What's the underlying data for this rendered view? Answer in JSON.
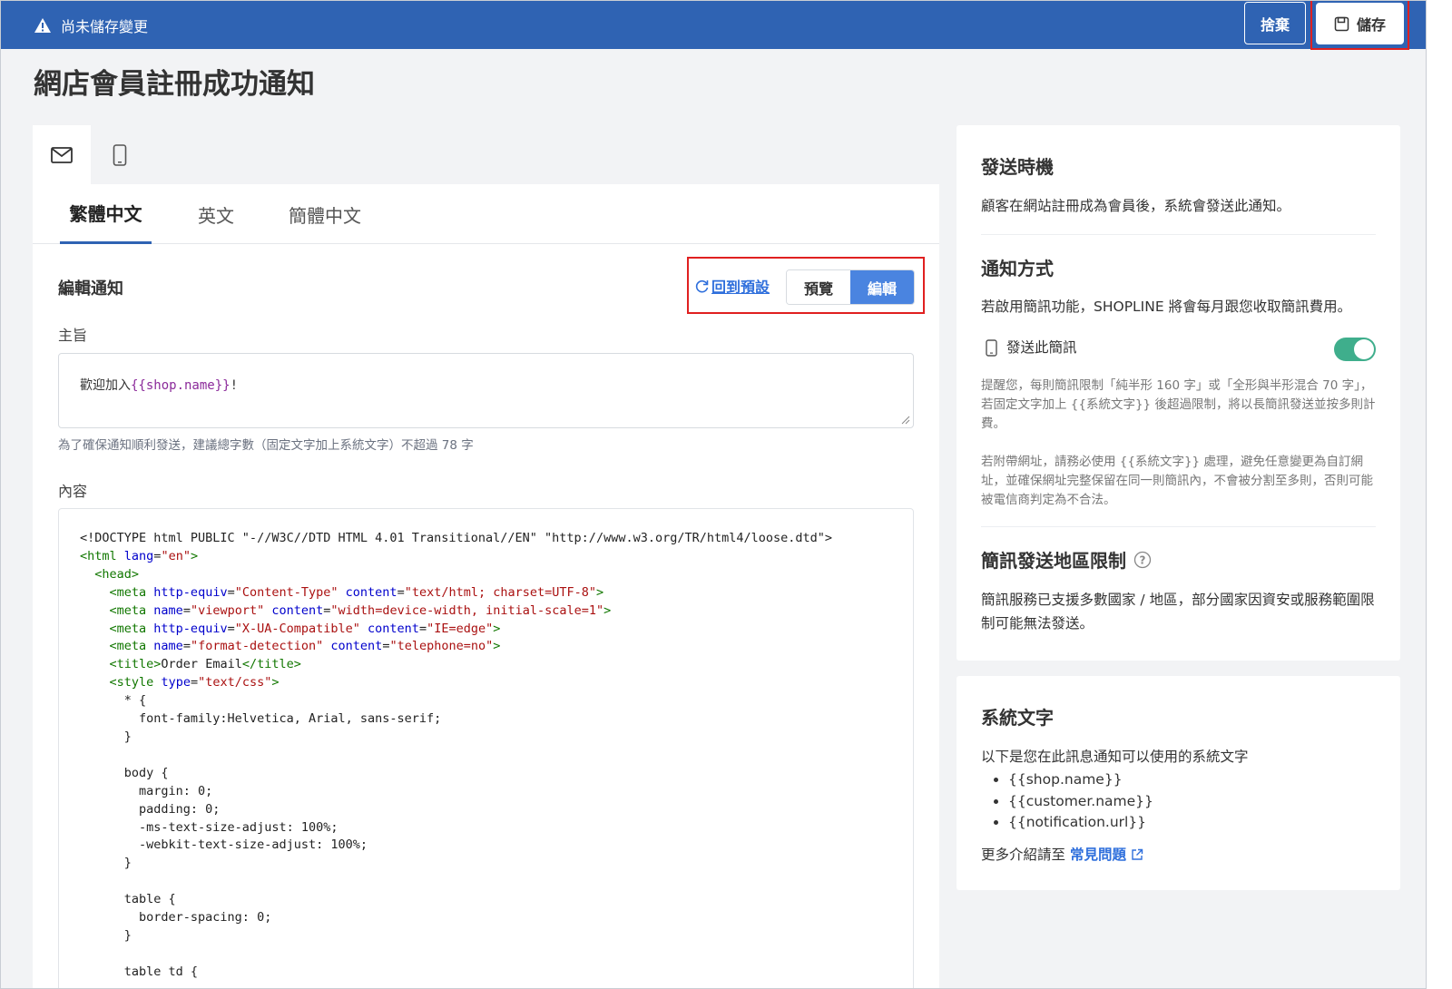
{
  "topbar": {
    "unsaved_text": "尚未儲存變更",
    "discard_label": "捨棄",
    "save_label": "儲存"
  },
  "page": {
    "title": "網店會員註冊成功通知"
  },
  "editor": {
    "lang_tabs": [
      "繁體中文",
      "英文",
      "簡體中文"
    ],
    "section_title": "編輯通知",
    "reset_label": "回到預設",
    "preview_label": "預覽",
    "edit_label": "編輯",
    "subject_label": "主旨",
    "subject_prefix": "歡迎加入",
    "subject_var": "{{shop.name}}",
    "subject_suffix": "!",
    "subject_hint": "為了確保通知順利發送，建議總字數（固定文字加上系統文字）不超過 78 字",
    "content_label": "內容"
  },
  "send_timing": {
    "title": "發送時機",
    "desc": "顧客在網站註冊成為會員後，系統會發送此通知。"
  },
  "notify_method": {
    "title": "通知方式",
    "desc": "若啟用簡訊功能，SHOPLINE 將會每月跟您收取簡訊費用。",
    "sms_label": "發送此簡訊",
    "sms_enabled": true,
    "note1": "提醒您，每則簡訊限制「純半形 160 字」或「全形與半形混合 70 字」，若固定文字加上 {{系統文字}} 後超過限制，將以長簡訊發送並按多則計費。",
    "note2": "若附帶網址，請務必使用 {{系統文字}} 處理，避免任意變更為自訂網址，並確保網址完整保留在同一則簡訊內，不會被分割至多則，否則可能被電信商判定為不合法。"
  },
  "region_limit": {
    "title": "簡訊發送地區限制",
    "desc": "簡訊服務已支援多數國家 / 地區，部分國家因資安或服務範圍限制可能無法發送。"
  },
  "system_text": {
    "title": "系統文字",
    "desc": "以下是您在此訊息通知可以使用的系統文字",
    "vars": [
      "{{shop.name}}",
      "{{customer.name}}",
      "{{notification.url}}"
    ],
    "more_prefix": "更多介紹請至 ",
    "faq_label": "常見問題"
  },
  "colors": {
    "topbar": "#2f63b3",
    "accent": "#4a84e0",
    "link": "#2f6fdc",
    "toggle_on": "#3fae8c",
    "highlight_box": "#e02020"
  }
}
